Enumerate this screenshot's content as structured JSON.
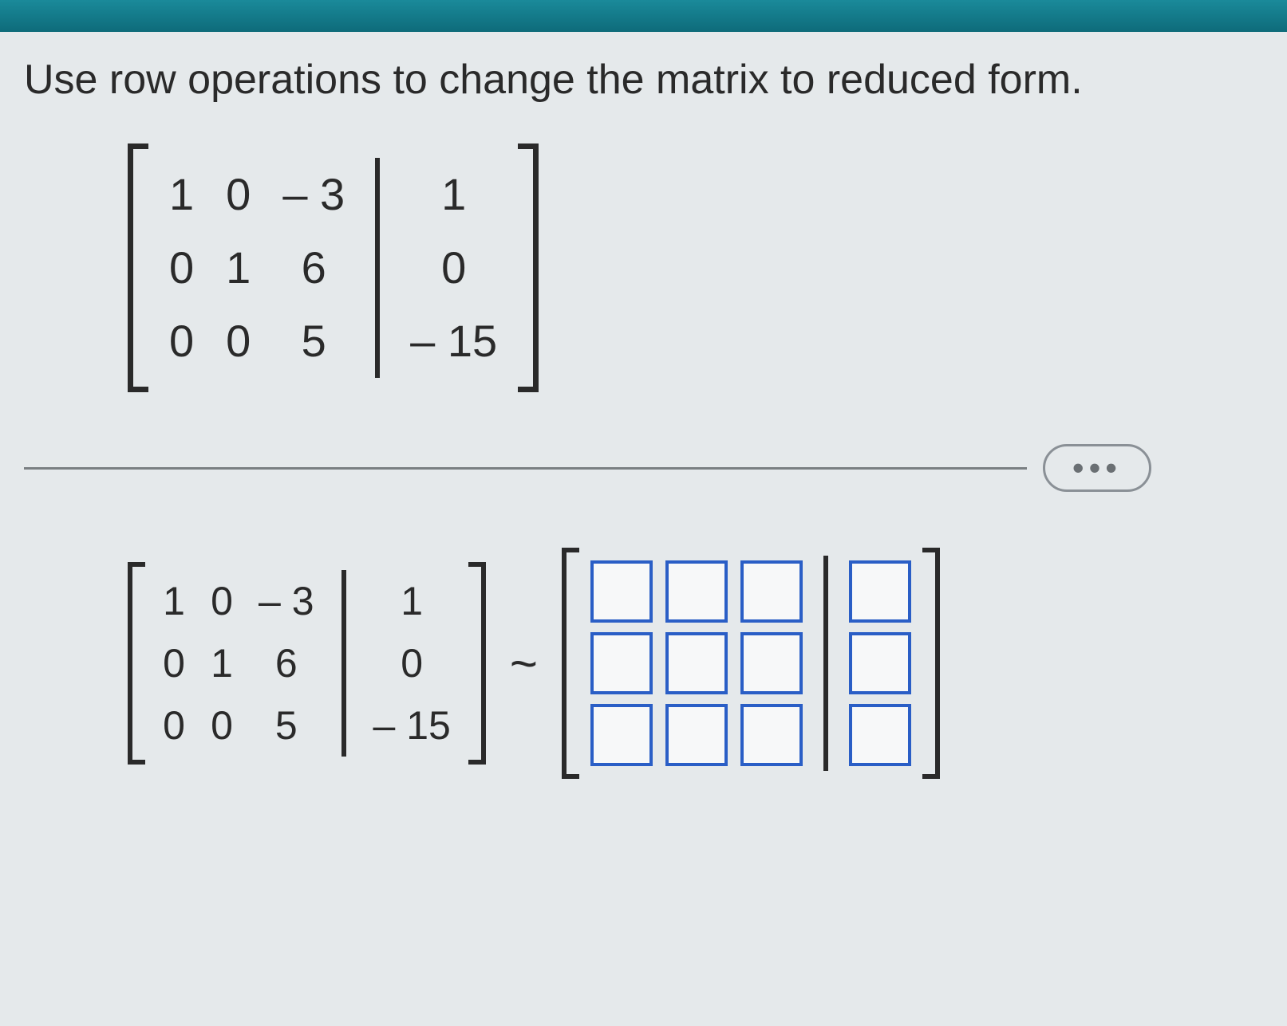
{
  "instruction": "Use row operations to change the matrix to reduced form.",
  "more_label": "•••",
  "tilde": "~",
  "matrix_top": {
    "rows": [
      {
        "c1": "1",
        "c2": "0",
        "c3": "– 3",
        "aug": "1"
      },
      {
        "c1": "0",
        "c2": "1",
        "c3": "6",
        "aug": "0"
      },
      {
        "c1": "0",
        "c2": "0",
        "c3": "5",
        "aug": "– 15"
      }
    ]
  },
  "matrix_left": {
    "rows": [
      {
        "c1": "1",
        "c2": "0",
        "c3": "– 3",
        "aug": "1"
      },
      {
        "c1": "0",
        "c2": "1",
        "c3": "6",
        "aug": "0"
      },
      {
        "c1": "0",
        "c2": "0",
        "c3": "5",
        "aug": "– 15"
      }
    ]
  },
  "answer_matrix": {
    "rows": 3,
    "left_cols": 3,
    "aug_cols": 1
  }
}
